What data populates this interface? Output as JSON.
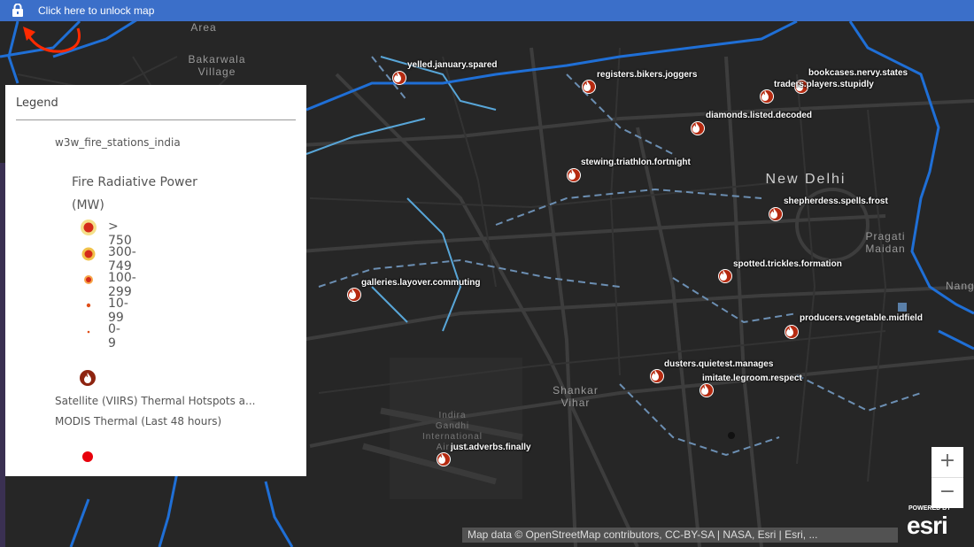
{
  "topbar": {
    "unlock_label": "Click here to unlock map",
    "lock_icon": "lock-icon"
  },
  "places": {
    "area": "Area",
    "bakarwala": "Bakarwala\nVillage",
    "new_delhi": "New Delhi",
    "pragati": "Pragati\nMaidan",
    "shankar": "Shankar\nVihar",
    "indira": "Indira\nGandhi\nInternational\nAirport",
    "nang": "Nang"
  },
  "points": [
    {
      "label": "yelled.january.spared"
    },
    {
      "label": "registers.bikers.joggers"
    },
    {
      "label": "bookcases.nervy.states"
    },
    {
      "label": "traders.players.stupidly"
    },
    {
      "label": "diamonds.listed.decoded"
    },
    {
      "label": "stewing.triathlon.fortnight"
    },
    {
      "label": "shepherdess.spells.frost"
    },
    {
      "label": "spotted.trickles.formation"
    },
    {
      "label": "galleries.layover.commuting"
    },
    {
      "label": "producers.vegetable.midfield"
    },
    {
      "label": "dusters.quietest.manages"
    },
    {
      "label": "imitate.legroom.respect"
    },
    {
      "label": "just.adverbs.finally"
    }
  ],
  "legend": {
    "title": "Legend",
    "layer": "w3w_fire_stations_india",
    "field": "Fire Radiative Power (MW)",
    "classes": [
      {
        "label": "> 750"
      },
      {
        "label": "300-749"
      },
      {
        "label": "100-299"
      },
      {
        "label": "10-99"
      },
      {
        "label": "0-9"
      }
    ],
    "viirs_label": "Satellite (VIIRS) Thermal Hotspots a...",
    "modis_label": "MODIS Thermal (Last 48 hours)"
  },
  "zoom": {
    "in": "+",
    "out": "−"
  },
  "attribution": "Map data © OpenStreetMap contributors, CC-BY-SA | NASA, Esri | Esri, ...",
  "esri": {
    "powered": "POWERED BY",
    "logo": "esri"
  },
  "colors": {
    "topbar": "#3b6fc9",
    "map_bg": "#262626",
    "river": "#1f6fd6",
    "fire_marker": "#b52a10",
    "hotspot_red": "#e8000b"
  }
}
